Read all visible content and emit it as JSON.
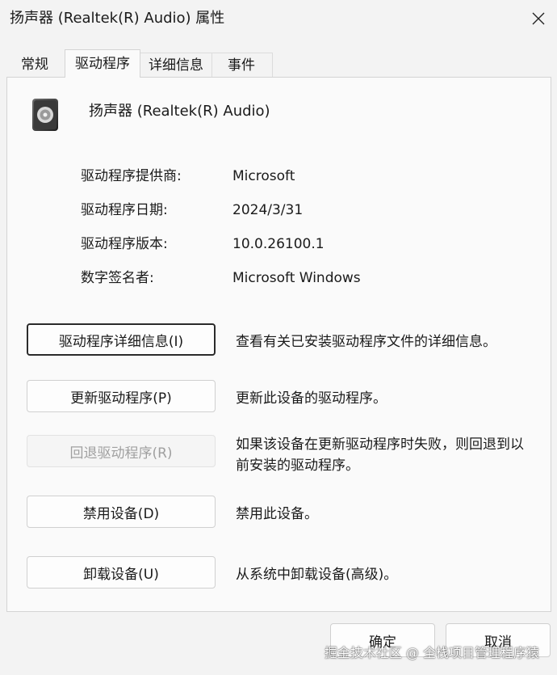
{
  "window": {
    "title": "扬声器 (Realtek(R) Audio) 属性"
  },
  "tabs": [
    {
      "label": "常规"
    },
    {
      "label": "驱动程序"
    },
    {
      "label": "详细信息"
    },
    {
      "label": "事件"
    }
  ],
  "device": {
    "name": "扬声器 (Realtek(R) Audio)",
    "icon": "speaker-device-icon"
  },
  "info": {
    "provider_label": "驱动程序提供商:",
    "provider_value": "Microsoft",
    "date_label": "驱动程序日期:",
    "date_value": "2024/3/31",
    "version_label": "驱动程序版本:",
    "version_value": "10.0.26100.1",
    "signer_label": "数字签名者:",
    "signer_value": "Microsoft Windows"
  },
  "actions": {
    "details_label": "驱动程序详细信息(I)",
    "details_desc": "查看有关已安装驱动程序文件的详细信息。",
    "update_label": "更新驱动程序(P)",
    "update_desc": "更新此设备的驱动程序。",
    "rollback_label": "回退驱动程序(R)",
    "rollback_desc": "如果该设备在更新驱动程序时失败，则回退到以前安装的驱动程序。",
    "disable_label": "禁用设备(D)",
    "disable_desc": "禁用此设备。",
    "uninstall_label": "卸载设备(U)",
    "uninstall_desc": "从系统中卸载设备(高级)。"
  },
  "footer": {
    "ok_label": "确定",
    "cancel_label": "取消"
  },
  "watermark": "掘金技术社区 @ 全栈项目管理程序猿"
}
